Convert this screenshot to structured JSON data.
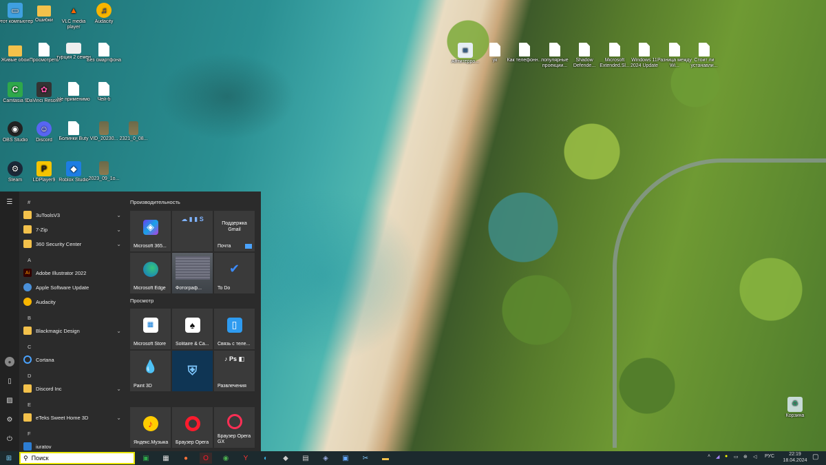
{
  "desktop": {
    "icons": [
      {
        "label": "Этот компьютер",
        "icon": "computer-icon"
      },
      {
        "label": "Ошибки",
        "icon": "folder-icon"
      },
      {
        "label": "VLC media player",
        "icon": "vlc-icon"
      },
      {
        "label": "Audacity",
        "icon": "audacity-icon"
      },
      {
        "label": "Живые обои",
        "icon": "folder-icon"
      },
      {
        "label": "Просмотреть",
        "icon": "file-icon"
      },
      {
        "label": "турция 2 семен",
        "icon": "file-icon"
      },
      {
        "label": "Без смартфона",
        "icon": "file-icon"
      },
      {
        "label": "Camtasia 9",
        "icon": "camtasia-icon"
      },
      {
        "label": "DaVinci Resolve",
        "icon": "davinci-icon"
      },
      {
        "label": "Не применимо",
        "icon": "file-icon"
      },
      {
        "label": "Чей-б",
        "icon": "file-icon"
      },
      {
        "label": "OBS Studio",
        "icon": "obs-icon"
      },
      {
        "label": "Discord",
        "icon": "discord-icon"
      },
      {
        "label": "Болинки Buty",
        "icon": "file-icon"
      },
      {
        "label": "VID_20230...",
        "icon": "video-icon"
      },
      {
        "label": "2321_0_08...",
        "icon": "video-icon"
      },
      {
        "label": "Steam",
        "icon": "steam-icon"
      },
      {
        "label": "LDPlayer9",
        "icon": "ldplayer-icon"
      },
      {
        "label": "Roblox Studio",
        "icon": "roblox-icon"
      },
      {
        "label": "2023_09_1o...",
        "icon": "video-icon"
      },
      {
        "label": "Антитерро...",
        "icon": "file-icon"
      },
      {
        "label": "ук",
        "icon": "file-icon"
      },
      {
        "label": "Как телефонн...",
        "icon": "file-icon"
      },
      {
        "label": "популярные проекции...",
        "icon": "file-icon"
      },
      {
        "label": "Shadow Defende...",
        "icon": "file-icon"
      },
      {
        "label": "Microsoft Extended.Sl...",
        "icon": "file-icon"
      },
      {
        "label": "Windows 11 2024 Update",
        "icon": "file-icon"
      },
      {
        "label": "Разница между Wi...",
        "icon": "file-icon"
      },
      {
        "label": "Стоит ли устанавли...",
        "icon": "file-icon"
      },
      {
        "label": "Корзина",
        "icon": "recycle-bin-icon"
      }
    ]
  },
  "start_menu": {
    "letters": [
      "#",
      "A",
      "B",
      "C",
      "D",
      "E",
      "F"
    ],
    "apps": [
      {
        "label": "3uToolsV3",
        "icon": "folder-icon",
        "expand": true
      },
      {
        "label": "7-Zip",
        "icon": "folder-icon",
        "expand": true
      },
      {
        "label": "360 Security Center",
        "icon": "folder-icon",
        "expand": true
      },
      {
        "label": "Adobe Illustrator 2022",
        "icon": "illustrator-icon",
        "expand": false
      },
      {
        "label": "Apple Software Update",
        "icon": "apple-update-icon",
        "expand": false
      },
      {
        "label": "Audacity",
        "icon": "audacity-icon",
        "expand": false
      },
      {
        "label": "Blackmagic Design",
        "icon": "folder-icon",
        "expand": true
      },
      {
        "label": "Cortana",
        "icon": "cortana-icon",
        "expand": false
      },
      {
        "label": "Discord Inc",
        "icon": "folder-icon",
        "expand": true
      },
      {
        "label": "eTeks Sweet Home 3D",
        "icon": "folder-icon",
        "expand": true
      },
      {
        "label": "iuratov",
        "icon": "app-icon",
        "expand": false
      }
    ],
    "groups": [
      {
        "title": "Производительность"
      },
      {
        "title": "Просмотр"
      }
    ],
    "tiles": [
      {
        "label": "Microsoft 365...",
        "icon": "m365-icon"
      },
      {
        "label": "",
        "icon": "office-apps-icon"
      },
      {
        "label": "Почта",
        "icon": "mail-icon",
        "top_text": "Поддержка Gmail"
      },
      {
        "label": "Microsoft Edge",
        "icon": "edge-icon"
      },
      {
        "label": "Фотограф...",
        "icon": "photos-icon"
      },
      {
        "label": "To Do",
        "icon": "todo-icon"
      },
      {
        "label": "Microsoft Store",
        "icon": "store-icon"
      },
      {
        "label": "Solitaire & Ca...",
        "icon": "solitaire-icon"
      },
      {
        "label": "Связь с теле...",
        "icon": "phone-link-icon"
      },
      {
        "label": "Paint 3D",
        "icon": "paint3d-icon"
      },
      {
        "label": "",
        "icon": "shield-icon"
      },
      {
        "label": "Развлечения",
        "icon": "entertainment-icon"
      },
      {
        "label": "Яндекс.Музыка",
        "icon": "yandex-music-icon"
      },
      {
        "label": "Браузер Opera",
        "icon": "opera-icon"
      },
      {
        "label": "Браузер Opera GX",
        "icon": "opera-gx-icon"
      }
    ]
  },
  "taskbar": {
    "search_placeholder": "Поиск",
    "language": "РУС",
    "time": "22:19",
    "date": "18.04.2024"
  },
  "colors": {
    "start_bg": "#2b2b2b",
    "tile_bg": "#3a3a3a",
    "taskbar_bg": "#1c2a2e",
    "search_border": "#e8e400"
  }
}
